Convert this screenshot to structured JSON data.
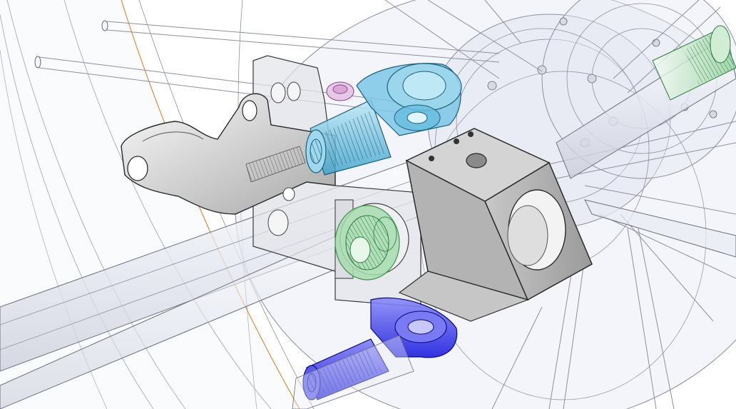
{
  "viewport": {
    "background": "#ffffff"
  },
  "palette": {
    "edge_dark": "#2a2a2a",
    "edge_mid": "#555555",
    "ghost_fill": "#e9ecf5",
    "ghost_fill_2": "#dfe3ef",
    "ghost_edge": "#8c90a0",
    "rim_highlight": "#d07a1a",
    "metal_light": "#f2f2f2",
    "metal_mid": "#bdbdbd",
    "metal_dark": "#8f8f8f",
    "cyan_part": "#4fb3d9",
    "cyan_part_light": "#9fd8ee",
    "blue_part": "#2a2af0",
    "blue_part_light": "#7a7af5",
    "green_part": "#8fd19a",
    "green_part_dark": "#3f8f4f",
    "pink_part": "#d9a8d9"
  },
  "parts": [
    {
      "name": "wheel-rim",
      "color_key": "ghost_fill"
    },
    {
      "name": "hub-flange",
      "color_key": "ghost_fill_2"
    },
    {
      "name": "spokes",
      "color_key": "ghost_edge"
    },
    {
      "name": "axle",
      "color_key": "ghost_fill"
    },
    {
      "name": "mount-bracket",
      "color_key": "metal_light"
    },
    {
      "name": "cyan-rod-end",
      "color_key": "cyan_part"
    },
    {
      "name": "blue-rod-end",
      "color_key": "blue_part"
    },
    {
      "name": "green-bearing",
      "color_key": "green_part"
    },
    {
      "name": "clamp-block",
      "color_key": "metal_mid"
    },
    {
      "name": "pink-bolt-head",
      "color_key": "pink_part"
    },
    {
      "name": "threaded-axle-end",
      "color_key": "green_part"
    }
  ]
}
